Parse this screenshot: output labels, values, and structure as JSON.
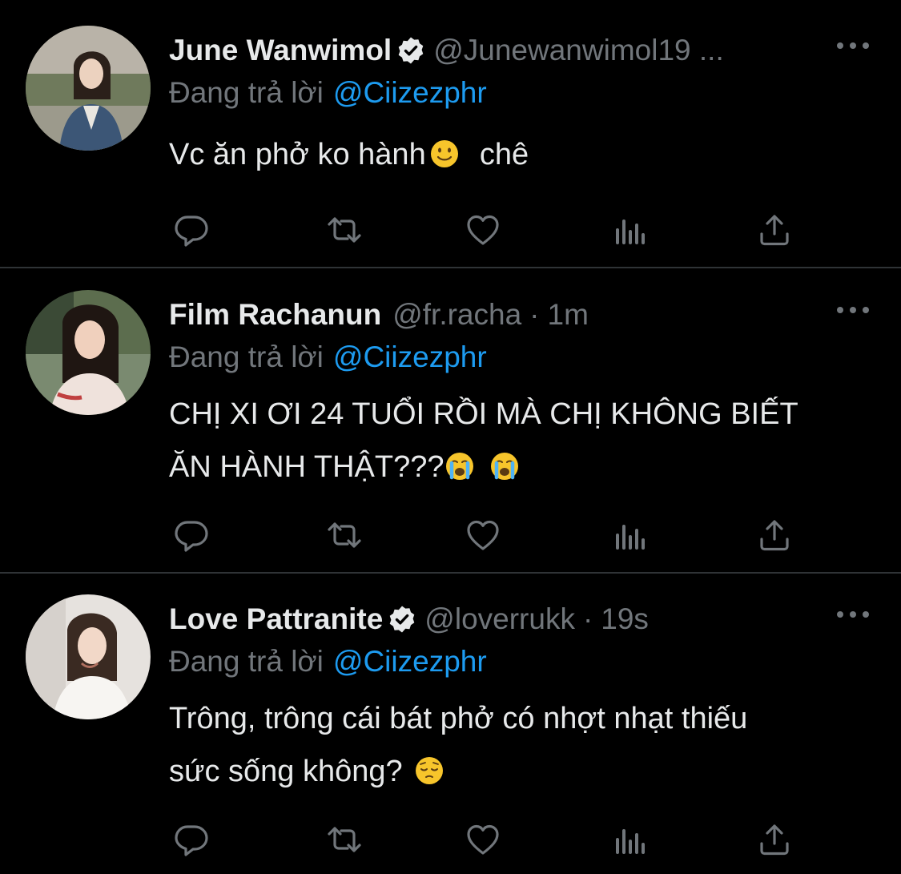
{
  "reply_prefix": "Đang trả lời",
  "colors": {
    "background": "#000000",
    "text": "#e7e9ea",
    "secondary": "#71767b",
    "accent": "#1d9bf0",
    "divider": "#2f3336"
  },
  "tweets": [
    {
      "name": "June Wanwimol",
      "verified": true,
      "handle": "@Junewanwimol19 ...",
      "time": "",
      "replying_to": "@Ciizezphr",
      "line1": "Vc ăn phở ko hành",
      "emoji1": "slightly-smiling-face",
      "line1_after": "chê",
      "line2": ""
    },
    {
      "name": "Film Rachanun",
      "verified": false,
      "handle": "@fr.racha",
      "time": "1m",
      "replying_to": "@Ciizezphr",
      "line1": "CHỊ XI ƠI 24 TUỔI RỒI MÀ CHỊ KHÔNG BIẾT",
      "line2": "ĂN HÀNH THẬT???",
      "emoji2": "loudly-crying-face"
    },
    {
      "name": "Love Pattranite",
      "verified": true,
      "handle": "@loverrukk",
      "time": "19s",
      "replying_to": "@Ciizezphr",
      "line1": "Trông, trông cái bát phở có nhợt nhạt thiếu",
      "line2": "sức sống không?",
      "emoji2": "pensive-face"
    }
  ],
  "actions": [
    "reply-icon",
    "retweet-icon",
    "like-icon",
    "views-icon",
    "share-icon"
  ]
}
